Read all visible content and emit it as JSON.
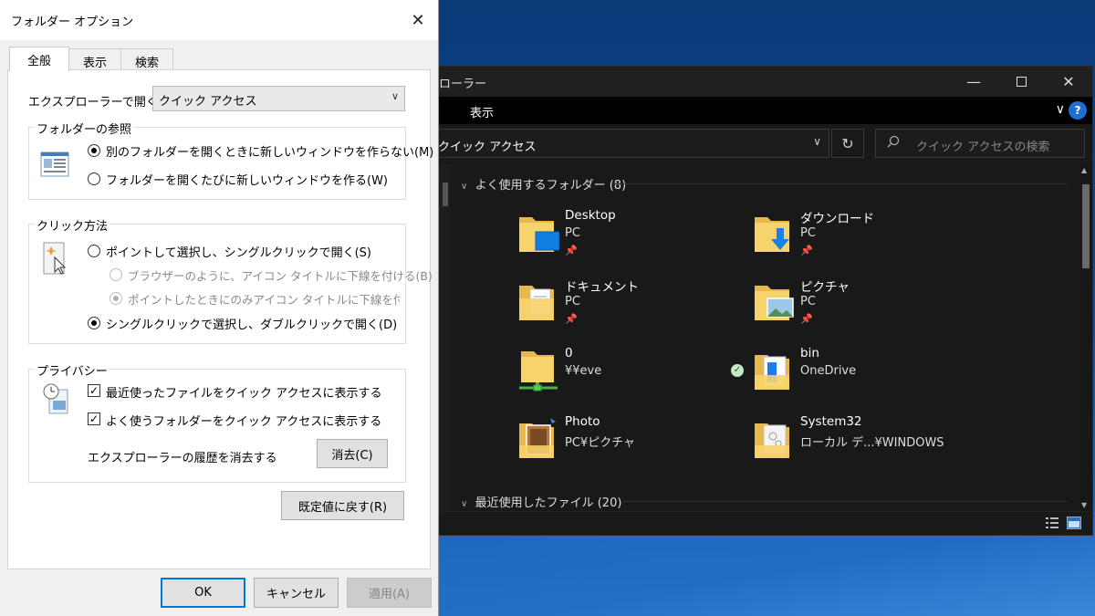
{
  "colors": {
    "accent": "#0078d7",
    "explorer_bg": "#191919",
    "dialog_bg": "#f0f0f0"
  },
  "explorer": {
    "title": "ローラー",
    "menu_view": "表示",
    "address": "クイック アクセス",
    "search_placeholder": "クイック アクセスの検索",
    "frequent_header": "よく使用するフォルダー (8)",
    "recent_header": "最近使用したファイル (20)",
    "folders": [
      {
        "name": "Desktop",
        "sub": "PC",
        "pinned": true,
        "icon": "desktop-folder-icon"
      },
      {
        "name": "ダウンロード",
        "sub": "PC",
        "pinned": true,
        "icon": "downloads-folder-icon"
      },
      {
        "name": "ドキュメント",
        "sub": "PC",
        "pinned": true,
        "icon": "documents-folder-icon"
      },
      {
        "name": "ピクチャ",
        "sub": "PC",
        "pinned": true,
        "icon": "pictures-folder-icon"
      },
      {
        "name": "0",
        "sub": "¥¥eve",
        "pinned": false,
        "icon": "network-folder-icon"
      },
      {
        "name": "bin",
        "sub": "OneDrive",
        "pinned": false,
        "icon": "onedrive-folder-icon"
      },
      {
        "name": "Photo",
        "sub": "PC¥ピクチャ",
        "pinned": false,
        "icon": "photo-folder-icon"
      },
      {
        "name": "System32",
        "sub": "ローカル デ...¥WINDOWS",
        "pinned": false,
        "icon": "system-folder-icon"
      }
    ]
  },
  "dialog": {
    "title": "フォルダー オプション",
    "tabs": [
      "全般",
      "表示",
      "検索"
    ],
    "open_explorer_label": "エクスプローラーで開く:",
    "open_explorer_value": "クイック アクセス",
    "browse_group": "フォルダーの参照",
    "browse_same_window": "別のフォルダーを開くときに新しいウィンドウを作らない(M)",
    "browse_new_window": "フォルダーを開くたびに新しいウィンドウを作る(W)",
    "click_group": "クリック方法",
    "single_click": "ポイントして選択し、シングルクリックで開く(S)",
    "underline_browser": "ブラウザーのように、アイコン タイトルに下線を付ける(B)",
    "underline_point": "ポイントしたときにのみアイコン タイトルに下線を付ける(P",
    "double_click": "シングルクリックで選択し、ダブルクリックで開く(D)",
    "privacy_group": "プライバシー",
    "show_recent_files": "最近使ったファイルをクイック アクセスに表示する",
    "show_frequent_folders": "よく使うフォルダーをクイック アクセスに表示する",
    "clear_history_label": "エクスプローラーの履歴を消去する",
    "clear_button": "消去(C)",
    "restore_defaults": "既定値に戻す(R)",
    "ok": "OK",
    "cancel": "キャンセル",
    "apply": "適用(A)"
  }
}
